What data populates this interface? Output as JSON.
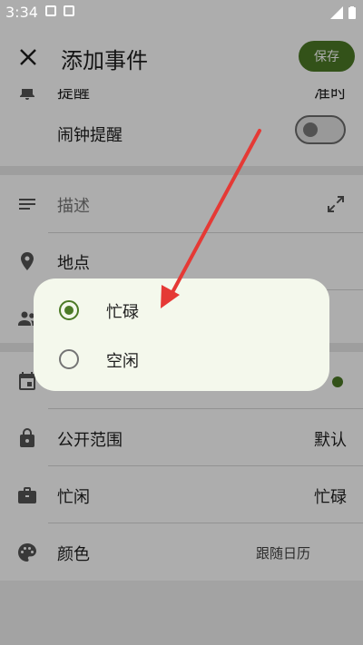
{
  "status_bar": {
    "time": "3:34"
  },
  "app_bar": {
    "close_icon": "close-icon",
    "title": "添加事件",
    "save_label": "保存"
  },
  "partial_row": {
    "label": "提醒",
    "value": "准时"
  },
  "alarm": {
    "label": "闹钟提醒",
    "enabled": false
  },
  "description": {
    "placeholder": "描述"
  },
  "location": {
    "label": "地点"
  },
  "visibility": {
    "label": "公开范围",
    "value": "默认"
  },
  "availability": {
    "label": "忙闲",
    "value": "忙碌"
  },
  "color": {
    "label": "颜色",
    "value": "跟随日历"
  },
  "dialog": {
    "options": [
      {
        "label": "忙碌",
        "selected": true
      },
      {
        "label": "空闲",
        "selected": false
      }
    ]
  },
  "colors": {
    "accent": "#4c7a26",
    "annotation": "#e53935",
    "dialog_bg": "#f4f8ec"
  }
}
